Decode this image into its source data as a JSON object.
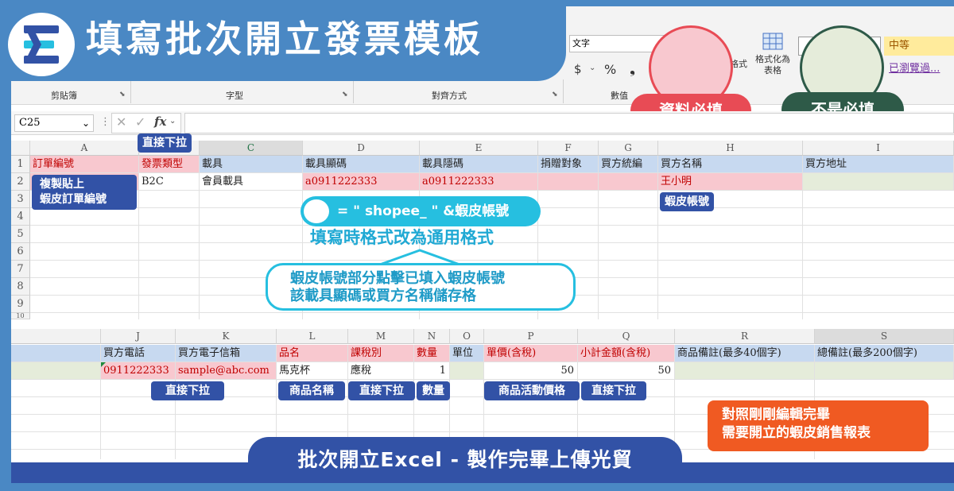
{
  "banner": {
    "title": "填寫批次開立發票模板",
    "logo_letter": "E"
  },
  "ribbon": {
    "number_format": "文字",
    "currency": "$",
    "percent": "%",
    "comma": "❟",
    "format_as_table": "格式化為表格",
    "format_as_table_line1": "格式化為",
    "format_as_table_line2": "表格",
    "cond_fmt_suffix": "格式",
    "style_medium": "中等",
    "style_visited": "已瀏覽過...",
    "group_clipboard": "剪貼簿",
    "group_font": "字型",
    "group_alignment": "對齊方式",
    "group_number": "數值"
  },
  "legend": {
    "required": "資料必填",
    "optional": "不是必填"
  },
  "formula_bar": {
    "name_box": "C25",
    "fx": "fx",
    "value": ""
  },
  "top_cols": [
    "A",
    "B",
    "C",
    "D",
    "E",
    "F",
    "G",
    "H",
    "I"
  ],
  "row_nums": [
    "1",
    "2",
    "3",
    "4",
    "5",
    "6",
    "7",
    "8",
    "9",
    "10"
  ],
  "top_headers": [
    "訂單編號",
    "發票類型",
    "載具",
    "載具顯碼",
    "載具隱碼",
    "捐贈對象",
    "買方統編",
    "買方名稱",
    "買方地址"
  ],
  "top_row2": [
    "",
    "B2C",
    "會員載具",
    "a0911222333",
    "a0911222333",
    "",
    "",
    "王小明",
    ""
  ],
  "bottom_cols": [
    "J",
    "K",
    "L",
    "M",
    "N",
    "O",
    "P",
    "Q",
    "R",
    "S"
  ],
  "bottom_headers": [
    "買方電話",
    "買方電子信箱",
    "品名",
    "課稅別",
    "數量",
    "單位",
    "單價(含稅)",
    "小計金額(含稅)",
    "商品備註(最多40個字)",
    "總備註(最多200個字)"
  ],
  "bottom_row2": [
    "0911222333",
    "sample@abc.com",
    "馬克杯",
    "應稅",
    "1",
    "",
    "50",
    "50",
    "",
    ""
  ],
  "callouts": {
    "dropdown_top": "直接下拉",
    "copy_paste_line1": "複製貼上",
    "copy_paste_line2": "蝦皮訂單編號",
    "shopee_account": "蝦皮帳號",
    "formula": "= \" shopee_ \" &蝦皮帳號",
    "general_format": "填寫時格式改為通用格式",
    "note_line1": "蝦皮帳號部分點擊已填入蝦皮帳號",
    "note_line2": "該載具顯碼或買方名稱儲存格",
    "dropdown_k": "直接下拉",
    "product_name": "商品名稱",
    "dropdown_m": "直接下拉",
    "quantity": "數量",
    "activity_price": "商品活動價格",
    "dropdown_q": "直接下拉",
    "compare_line1": "對照剛剛編輯完畢",
    "compare_line2": "需要開立的蝦皮銷售報表"
  },
  "footer": {
    "title": "批次開立Excel - 製作完畢上傳光貿"
  },
  "colors": {
    "bg": "#4a88c4",
    "navy": "#3252a6",
    "teal": "#26bfe0",
    "required": "#e84b55",
    "optional": "#2e5a48",
    "orange": "#f05a22",
    "pink_fill": "#f8c8cf",
    "blue_fill": "#c7d9f0"
  }
}
